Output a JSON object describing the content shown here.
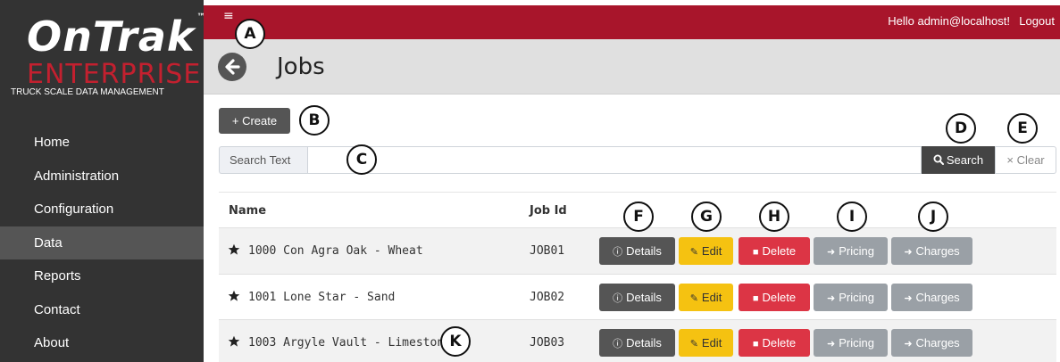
{
  "brand": {
    "logo_main": "OnTrak",
    "logo_tm": "™",
    "logo_sub": "ENTERPRISE",
    "tagline": "TRUCK SCALE DATA MANAGEMENT",
    "accent_color": "#a8152b"
  },
  "sidebar": {
    "items": [
      {
        "label": "Home"
      },
      {
        "label": "Administration"
      },
      {
        "label": "Configuration"
      },
      {
        "label": "Data",
        "active": true
      },
      {
        "label": "Reports"
      },
      {
        "label": "Contact"
      },
      {
        "label": "About"
      }
    ]
  },
  "topbar": {
    "menu_icon": "hamburger-icon",
    "menu_glyph": "≡",
    "greeting": "Hello admin@localhost!",
    "logout_label": "Logout"
  },
  "page": {
    "back_icon": "arrow-left-circle-icon",
    "title": "Jobs"
  },
  "toolbar": {
    "create_label": "+ Create"
  },
  "search": {
    "addon_label": "Search Text",
    "value": "",
    "search_label": "Search",
    "clear_label": "Clear",
    "search_icon": "search-icon",
    "clear_icon": "x-icon"
  },
  "table": {
    "headers": {
      "name": "Name",
      "job_id": "Job Id"
    },
    "buttons": {
      "details": "Details",
      "edit": "Edit",
      "delete": "Delete",
      "pricing": "Pricing",
      "charges": "Charges"
    },
    "rows": [
      {
        "name": "1000 Con Agra Oak - Wheat",
        "job_id": "JOB01"
      },
      {
        "name": "1001 Lone Star - Sand",
        "job_id": "JOB02"
      },
      {
        "name": "1003 Argyle Vault - Limestone",
        "job_id": "JOB03"
      }
    ]
  },
  "callouts": {
    "a": "A",
    "b": "B",
    "c": "C",
    "d": "D",
    "e": "E",
    "f": "F",
    "g": "G",
    "h": "H",
    "i": "I",
    "j": "J",
    "k": "K"
  }
}
